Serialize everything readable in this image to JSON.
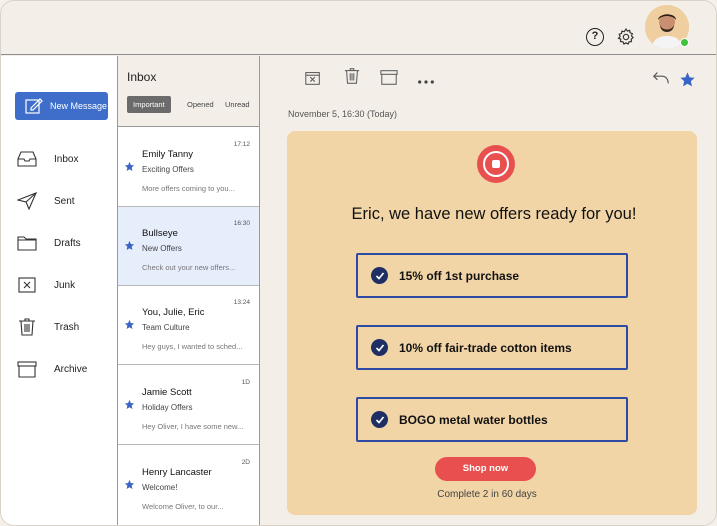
{
  "topbar": {
    "help_label": "?"
  },
  "sidebar": {
    "new_message_label": "New Message",
    "items": [
      {
        "label": "Inbox",
        "icon": "inbox-icon"
      },
      {
        "label": "Sent",
        "icon": "send-icon"
      },
      {
        "label": "Drafts",
        "icon": "folder-icon"
      },
      {
        "label": "Junk",
        "icon": "junk-icon"
      },
      {
        "label": "Trash",
        "icon": "trash-icon"
      },
      {
        "label": "Archive",
        "icon": "archive-icon"
      }
    ]
  },
  "list": {
    "title": "Inbox",
    "filters": [
      "Important",
      "Opened",
      "Unread"
    ],
    "messages": [
      {
        "from": "Emily Tanny",
        "time": "17:12",
        "subject": "Exciting Offers",
        "preview": "More offers coming to you..."
      },
      {
        "from": "Bullseye",
        "time": "16:30",
        "subject": "New Offers",
        "preview": "Check out your new offers..."
      },
      {
        "from": "You, Julie, Eric",
        "time": "13:24",
        "subject": "Team Culture",
        "preview": "Hey guys, I wanted to sched..."
      },
      {
        "from": "Jamie Scott",
        "time": "1D",
        "subject": "Holiday Offers",
        "preview": "Hey Oliver, I have some new..."
      },
      {
        "from": "Henry Lancaster",
        "time": "2D",
        "subject": "Welcome!",
        "preview": "Welcome Oliver, to our..."
      }
    ]
  },
  "reader": {
    "date": "November 5, 16:30 (Today)",
    "headline": "Eric, we have new offers ready for you!",
    "offers": [
      "15% off 1st purchase",
      "10% off fair-trade cotton items",
      "BOGO metal water bottles"
    ],
    "cta_label": "Shop now",
    "progress_text": "Complete 2 in 60 days"
  },
  "colors": {
    "accent": "#3e6ec9",
    "brand_red": "#e85050",
    "card_bg": "#f2d5a6",
    "offer_border": "#2e4aa5",
    "star": "#3a63c8"
  }
}
